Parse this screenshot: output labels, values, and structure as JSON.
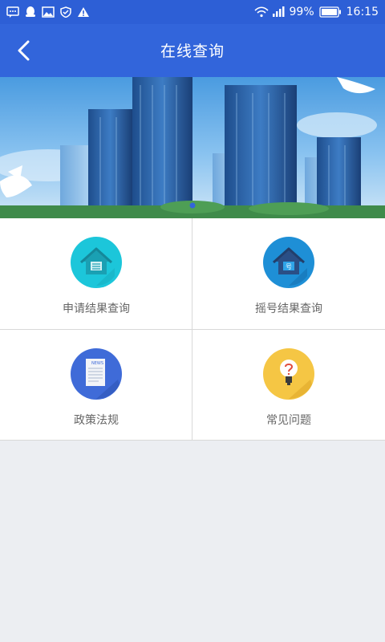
{
  "status_bar": {
    "battery_percent": "99%",
    "time": "16:15",
    "icons": [
      "message-icon",
      "qq-icon",
      "image-icon",
      "shield-icon",
      "warning-icon",
      "wifi-icon",
      "signal-icon",
      "battery-icon"
    ]
  },
  "header": {
    "title": "在线查询",
    "back_icon": "chevron-left-icon"
  },
  "banner": {
    "image": "city-buildings-with-doves",
    "active_indicator": 1
  },
  "menu": {
    "items": [
      {
        "label": "申请结果查询",
        "icon": "house-query-icon",
        "color": "#1CC6DA"
      },
      {
        "label": "摇号结果查询",
        "icon": "house-number-icon",
        "color": "#1E7BD0"
      },
      {
        "label": "政策法规",
        "icon": "news-document-icon",
        "color": "#3F6BD8"
      },
      {
        "label": "常见问题",
        "icon": "lightbulb-question-icon",
        "color": "#F5C644"
      }
    ]
  },
  "colors": {
    "primary": "#3265DB",
    "background": "#ECEEF2"
  }
}
